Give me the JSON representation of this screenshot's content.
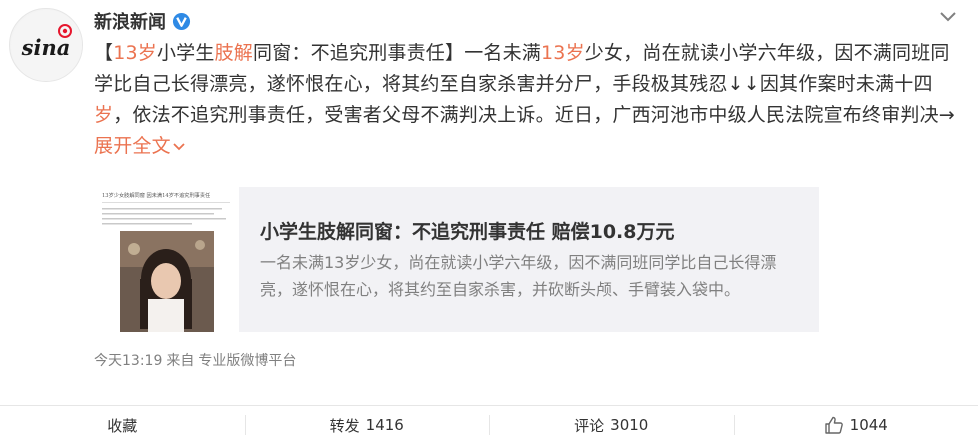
{
  "author": {
    "name": "新浪新闻",
    "logo_text": "sina"
  },
  "post": {
    "segments": [
      {
        "text": "【",
        "hl": false
      },
      {
        "text": "13岁",
        "hl": true
      },
      {
        "text": "小学生",
        "hl": false
      },
      {
        "text": "肢解",
        "hl": true
      },
      {
        "text": "同窗：不追究刑事责任】一名未满",
        "hl": false
      },
      {
        "text": "13岁",
        "hl": true
      },
      {
        "text": "少女，尚在就读小学六年级，因不满同班同学比自己长得漂亮，遂怀恨在心，将其约至自家杀害并分尸，手段极其残忍↓↓因其作案时未满十四",
        "hl": false
      },
      {
        "text": "岁",
        "hl": true
      },
      {
        "text": "，依法不追究刑事责任，受害者父母不满判决上诉。近日，广西河池市中级人民法院宣布终审判决→ ",
        "hl": false
      }
    ],
    "expand_label": "展开全文"
  },
  "card": {
    "title": "小学生肢解同窗：不追究刑事责任 赔偿10.8万元",
    "description": "一名未满13岁少女，尚在就读小学六年级，因不满同班同学比自己长得漂亮，遂怀恨在心，将其约至自家杀害，并砍断头颅、手臂装入袋中。",
    "thumb_headline": "13岁少女肢解同窗 因未满14岁不追究刑事责任"
  },
  "meta": {
    "time": "今天13:19",
    "from_label": "来自",
    "source": "专业版微博平台"
  },
  "actions": {
    "favorite": {
      "label": "收藏",
      "count": ""
    },
    "repost": {
      "label": "转发",
      "count": "1416"
    },
    "comment": {
      "label": "评论",
      "count": "3010"
    },
    "like": {
      "label": "",
      "count": "1044"
    }
  },
  "colors": {
    "highlight": "#eb7350",
    "card_bg": "#f2f2f5",
    "verified": "#2f8ae5",
    "logo_red": "#e6162d"
  },
  "icons": {
    "verified": "verified-badge-icon",
    "more": "chevron-down-icon",
    "expand": "chevron-down-icon",
    "like": "thumbs-up-icon"
  }
}
